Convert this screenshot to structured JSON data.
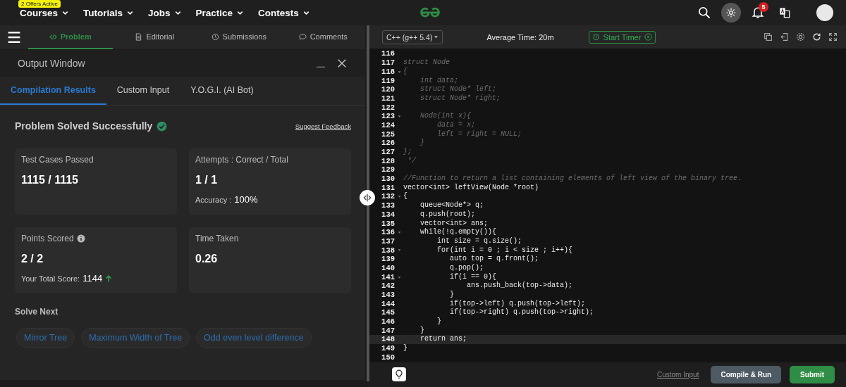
{
  "nav": {
    "offer_badge": "2 Offers Active",
    "items": [
      {
        "label": "Courses"
      },
      {
        "label": "Tutorials"
      },
      {
        "label": "Jobs"
      },
      {
        "label": "Practice"
      },
      {
        "label": "Contests"
      }
    ],
    "notification_count": "5"
  },
  "problem_tabs": [
    {
      "label": "Problem",
      "selected": true
    },
    {
      "label": "Editorial",
      "selected": false
    },
    {
      "label": "Submissions",
      "selected": false
    },
    {
      "label": "Comments",
      "selected": false
    }
  ],
  "output_window": {
    "title": "Output Window",
    "tabs": [
      {
        "label": "Compilation Results",
        "selected": true
      },
      {
        "label": "Custom Input",
        "selected": false
      },
      {
        "label": "Y.O.G.I. (AI Bot)",
        "selected": false
      }
    ],
    "status": "Problem Solved Successfully",
    "feedback_link": "Suggest Feedback",
    "cards": [
      {
        "label": "Test Cases Passed",
        "value": "1115 / 1115",
        "info": false
      },
      {
        "label": "Attempts : Correct / Total",
        "value": "1 / 1",
        "info": false,
        "note_label": "Accuracy :",
        "note_value": "100%",
        "rising": false
      },
      {
        "label": "Points Scored",
        "value": "2 / 2",
        "info": true,
        "note_label": "Your Total Score:",
        "note_value": "1144",
        "rising": true
      },
      {
        "label": "Time Taken",
        "value": "0.26",
        "info": false
      }
    ],
    "solve_next_heading": "Solve Next",
    "solve_next": [
      "Mirror Tree",
      "Maximum Width of Tree",
      "Odd even level difference"
    ]
  },
  "editor": {
    "language": "C++ (g++ 5.4)",
    "average_time": "Average Time: 20m",
    "timer_button": "Start Timer",
    "lines": [
      {
        "number": "116",
        "fold": false,
        "current": false
      },
      {
        "number": "117",
        "text": "struct Node",
        "kind": "comment",
        "fold": false,
        "current": false
      },
      {
        "number": "118",
        "text": "{",
        "kind": "comment",
        "fold": true,
        "current": false
      },
      {
        "number": "119",
        "text": "    int data;",
        "kind": "comment",
        "fold": false,
        "current": false
      },
      {
        "number": "120",
        "text": "    struct Node* left;",
        "kind": "comment",
        "fold": false,
        "current": false
      },
      {
        "number": "121",
        "text": "    struct Node* right;",
        "kind": "comment",
        "fold": false,
        "current": false
      },
      {
        "number": "122",
        "fold": false,
        "current": false
      },
      {
        "number": "123",
        "text": "    Node(int x){",
        "kind": "comment",
        "fold": true,
        "current": false
      },
      {
        "number": "124",
        "text": "        data = x;",
        "kind": "comment",
        "fold": false,
        "current": false
      },
      {
        "number": "125",
        "text": "        left = right = NULL;",
        "kind": "comment",
        "fold": false,
        "current": false
      },
      {
        "number": "126",
        "text": "    }",
        "kind": "comment",
        "fold": false,
        "current": false
      },
      {
        "number": "127",
        "text": "};",
        "kind": "comment",
        "fold": false,
        "current": false
      },
      {
        "number": "128",
        "text": " */",
        "kind": "comment",
        "fold": false,
        "current": false
      },
      {
        "number": "129",
        "fold": false,
        "current": false
      },
      {
        "number": "130",
        "text": "//Function to return a list containing elements of left view of the binary tree.",
        "kind": "comment",
        "fold": false,
        "current": false
      },
      {
        "number": "131",
        "text": "vector<int> leftView(Node *root)",
        "kind": "code",
        "fold": false,
        "current": false
      },
      {
        "number": "132",
        "text": "{",
        "kind": "code",
        "fold": true,
        "current": false
      },
      {
        "number": "133",
        "text": "    queue<Node*> q;",
        "kind": "code",
        "fold": false,
        "current": false
      },
      {
        "number": "134",
        "text": "    q.push(root);",
        "kind": "code",
        "fold": false,
        "current": false
      },
      {
        "number": "135",
        "text": "    vector<int> ans;",
        "kind": "code",
        "fold": false,
        "current": false
      },
      {
        "number": "136",
        "text": "    while(!q.empty()){",
        "kind": "code",
        "fold": true,
        "current": false
      },
      {
        "number": "137",
        "text": "        int size = q.size();",
        "kind": "code",
        "fold": false,
        "current": false
      },
      {
        "number": "138",
        "text": "        for(int i = 0 ; i < size ; i++){",
        "kind": "code",
        "fold": true,
        "current": false
      },
      {
        "number": "139",
        "text": "           auto top = q.front();",
        "kind": "code",
        "fold": false,
        "current": false
      },
      {
        "number": "140",
        "text": "           q.pop();",
        "kind": "code",
        "fold": false,
        "current": false
      },
      {
        "number": "141",
        "text": "           if(i == 0){",
        "kind": "code",
        "fold": true,
        "current": false
      },
      {
        "number": "142",
        "text": "               ans.push_back(top->data);",
        "kind": "code",
        "fold": false,
        "current": false
      },
      {
        "number": "143",
        "text": "           }",
        "kind": "code",
        "fold": false,
        "current": false
      },
      {
        "number": "144",
        "text": "           if(top->left) q.push(top->left);",
        "kind": "code",
        "fold": false,
        "current": false
      },
      {
        "number": "145",
        "text": "           if(top->right) q.push(top->right);",
        "kind": "code",
        "fold": false,
        "current": false
      },
      {
        "number": "146",
        "text": "        }",
        "kind": "code",
        "fold": false,
        "current": false
      },
      {
        "number": "147",
        "text": "    }",
        "kind": "code",
        "fold": false,
        "current": false
      },
      {
        "number": "148",
        "text": "    return ans;",
        "kind": "code",
        "fold": false,
        "current": true
      },
      {
        "number": "149",
        "text": "}",
        "kind": "code",
        "fold": false,
        "current": false
      },
      {
        "number": "150",
        "fold": false,
        "current": false
      }
    ],
    "custom_input_link": "Custom Input",
    "compile_button": "Compile & Run",
    "submit_button": "Submit"
  }
}
